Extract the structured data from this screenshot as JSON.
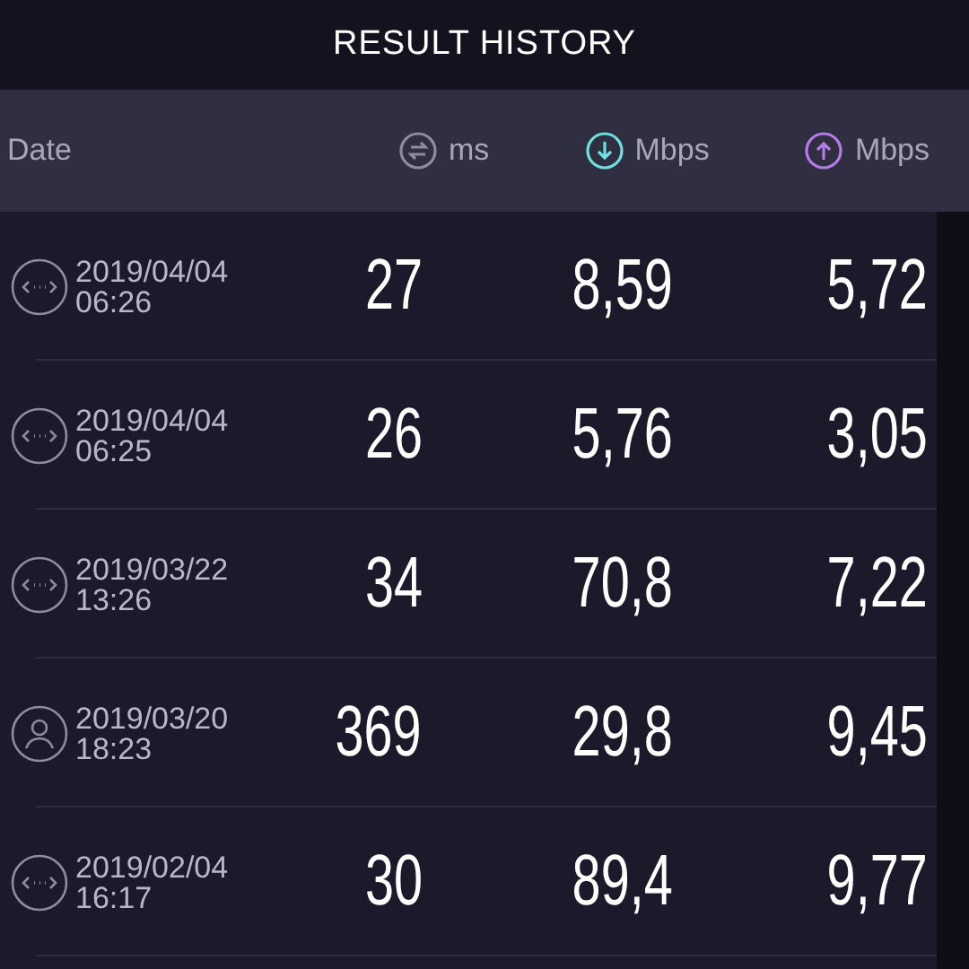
{
  "title": "RESULT HISTORY",
  "columns": [
    {
      "kind": "date",
      "label": "Date"
    },
    {
      "kind": "ping",
      "label": "ms"
    },
    {
      "kind": "download",
      "label": "Mbps"
    },
    {
      "kind": "upload",
      "label": "Mbps"
    }
  ],
  "rows": [
    {
      "kind": "multi",
      "date": "2019/04/04",
      "time": "06:26",
      "ping": "27",
      "download": "8,59",
      "upload": "5,72"
    },
    {
      "kind": "multi",
      "date": "2019/04/04",
      "time": "06:25",
      "ping": "26",
      "download": "5,76",
      "upload": "3,05"
    },
    {
      "kind": "multi",
      "date": "2019/03/22",
      "time": "13:26",
      "ping": "34",
      "download": "70,8",
      "upload": "7,22"
    },
    {
      "kind": "single",
      "date": "2019/03/20",
      "time": "18:23",
      "ping": "369",
      "download": "29,8",
      "upload": "9,45"
    },
    {
      "kind": "multi",
      "date": "2019/02/04",
      "time": "16:17",
      "ping": "30",
      "download": "89,4",
      "upload": "9,77"
    }
  ]
}
